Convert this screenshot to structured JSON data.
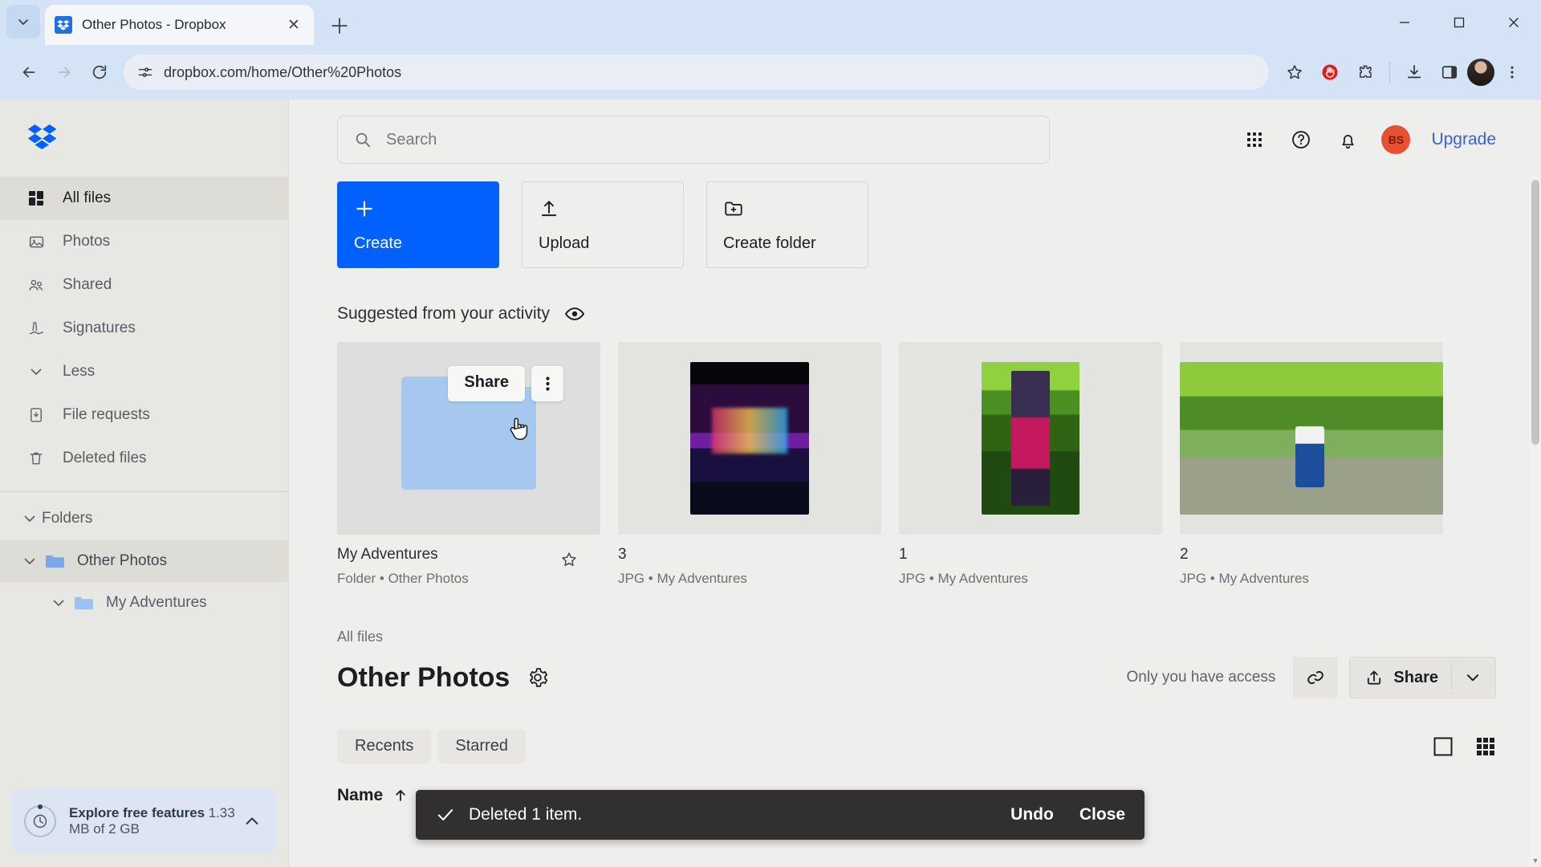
{
  "browser": {
    "tab": {
      "title": "Other Photos - Dropbox",
      "favicon": "dropbox-icon",
      "close": "close-icon"
    },
    "tab_list_button": "chevron-down-icon",
    "new_tab_button": "plus-icon",
    "window_controls": {
      "minimize": "minimize-icon",
      "maximize": "maximize-icon",
      "close": "close-icon"
    },
    "nav": {
      "back": "back-arrow-icon",
      "forward": "forward-arrow-icon",
      "reload": "reload-icon"
    },
    "omnibox": {
      "site_icon": "site-settings-icon",
      "url": "dropbox.com/home/Other%20Photos"
    },
    "toolbar": {
      "bookmark": "star-icon",
      "adblock": "adblock-shield-icon",
      "extensions": "extensions-puzzle-icon",
      "downloads": "download-icon",
      "side_panel": "side-panel-icon",
      "profile": "profile-avatar",
      "menu": "three-dot-menu-icon"
    }
  },
  "sidebar": {
    "logo": "dropbox-logo",
    "nav_items": [
      {
        "label": "All files",
        "icon": "all-files-icon",
        "active": true
      },
      {
        "label": "Photos",
        "icon": "photos-icon",
        "active": false
      },
      {
        "label": "Shared",
        "icon": "shared-people-icon",
        "active": false
      },
      {
        "label": "Signatures",
        "icon": "signature-pen-icon",
        "active": false
      },
      {
        "label": "Less",
        "icon": "chevron-down-icon",
        "active": false
      },
      {
        "label": "File requests",
        "icon": "file-request-icon",
        "active": false
      },
      {
        "label": "Deleted files",
        "icon": "trash-icon",
        "active": false
      }
    ],
    "folders_header": "Folders",
    "tree": [
      {
        "label": "Other Photos",
        "level": 1,
        "selected": true,
        "expanded": true
      },
      {
        "label": "My Adventures",
        "level": 2,
        "selected": false,
        "expanded": true
      }
    ],
    "upsell": {
      "title": "Explore free features",
      "subtitle": "1.33 MB of 2 GB",
      "icon": "storage-clock-icon",
      "collapse": "chevron-up-icon"
    }
  },
  "header": {
    "search": {
      "placeholder": "Search",
      "value": "",
      "icon": "search-icon"
    },
    "apps_icon": "grid-apps-icon",
    "help_icon": "help-question-icon",
    "notifications_icon": "bell-icon",
    "user_initials": "BS",
    "upgrade_label": "Upgrade"
  },
  "actions": [
    {
      "label": "Create",
      "icon": "plus-icon",
      "primary": true
    },
    {
      "label": "Upload",
      "icon": "upload-arrow-icon",
      "primary": false
    },
    {
      "label": "Create folder",
      "icon": "folder-plus-icon",
      "primary": false
    }
  ],
  "suggested": {
    "title": "Suggested from your activity",
    "eye_icon": "eye-icon",
    "hover_actions": {
      "share_label": "Share",
      "kebab": "three-dot-vertical-icon"
    },
    "cards": [
      {
        "name": "My Adventures",
        "meta": "Folder • Other Photos",
        "kind": "folder",
        "starred": false,
        "star_icon": "star-outline-icon"
      },
      {
        "name": "3",
        "meta": "JPG • My Adventures",
        "kind": "photo"
      },
      {
        "name": "1",
        "meta": "JPG • My Adventures",
        "kind": "photo"
      },
      {
        "name": "2",
        "meta": "JPG • My Adventures",
        "kind": "photo"
      }
    ]
  },
  "files_section": {
    "breadcrumb": "All files",
    "title": "Other Photos",
    "gear_icon": "gear-icon",
    "access_text": "Only you have access",
    "copy_link_icon": "link-icon",
    "share_label": "Share",
    "share_icon": "share-upload-icon",
    "share_caret": "chevron-down-icon",
    "tabs": [
      {
        "label": "Recents"
      },
      {
        "label": "Starred"
      }
    ],
    "view_list_icon": "list-view-icon",
    "view_grid_icon": "grid-view-icon",
    "columns": [
      {
        "label": "Name",
        "sort": "ascending",
        "sort_icon": "arrow-up-icon"
      }
    ]
  },
  "toast": {
    "check_icon": "check-icon",
    "message": "Deleted 1 item.",
    "undo_label": "Undo",
    "close_label": "Close"
  },
  "colors": {
    "dropbox_blue": "#0061fe",
    "accent_link": "#3b61d9",
    "avatar_red": "#e8512f",
    "toast_bg": "#32302f"
  }
}
